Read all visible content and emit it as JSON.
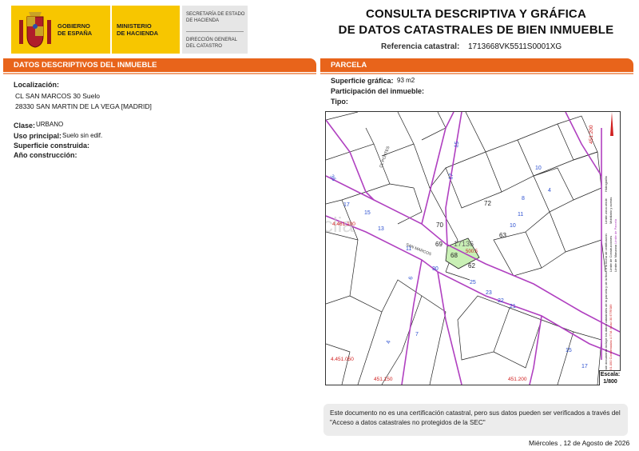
{
  "header": {
    "logo_line1": "GOBIERNO",
    "logo_line2": "DE ESPAÑA",
    "ministry_line1": "MINISTERIO",
    "ministry_line2": "DE HACIENDA",
    "secretaria_line1": "SECRETARÍA DE ESTADO",
    "secretaria_line2": "DE HACIENDA",
    "direccion_line1": "DIRECCIÓN GENERAL",
    "direccion_line2": "DEL CATASTRO",
    "title_line1": "CONSULTA DESCRIPTIVA Y GRÁFICA",
    "title_line2": "DE DATOS CATASTRALES DE BIEN INMUEBLE",
    "ref_label": "Referencia catastral:",
    "ref_value": "1713668VK5511S0001XG"
  },
  "left": {
    "section_title": "DATOS DESCRIPTIVOS DEL INMUEBLE",
    "localizacion_label": "Localización:",
    "address_line1": "CL SAN MARCOS 30 Suelo",
    "address_line2": "28330 SAN MARTIN DE LA VEGA [MADRID]",
    "clase_label": "Clase:",
    "clase_value": "URBANO",
    "uso_label": "Uso principal:",
    "uso_value": "Suelo sin edif.",
    "superficie_label": "Superficie construida:",
    "anio_label": "Año construcción:"
  },
  "right": {
    "section_title": "PARCELA",
    "sup_grafica_label": "Superficie gráfica:",
    "sup_grafica_value": "93 m2",
    "participacion_label": "Participación del inmueble:",
    "tipo_label": "Tipo:"
  },
  "map": {
    "parcel_color": "#c9f0b5",
    "boundary_color": "#b040c0",
    "street_color": "#2b4fd0",
    "coord_color": "#d02020",
    "watermark": "habitaclia",
    "street_sanmarcos": "SAN MARCOS",
    "street_ctpontes": "CL PONTES",
    "coord_left_top": "4.461.100",
    "coord_left_bottom": "4.451.050",
    "coord_bottom_mid": "451.150",
    "coord_bottom_right": "451.200",
    "coord_top_right": "451.200",
    "parcel_label": "68",
    "parcel_area": "500.5",
    "sheet_ref": "17136",
    "labels": {
      "n72": "72",
      "n70": "70",
      "n69": "69",
      "n63": "63",
      "n62": "62",
      "n36": "36",
      "n17": "17",
      "n13": "13",
      "n11": "11"
    },
    "side_text_1": "Este documento incluye los datos catastrales de la parcela y de la finca a la fecha de certificación",
    "side_text_2": "451.050 Coordenadas U.T.M. Huso 30 ETRS89",
    "legend_1": "Límite de Manzana",
    "legend_2": "Límite de Parcela",
    "legend_3": "Límite de Construcciones",
    "legend_4": "Mobiliario y aceras",
    "legend_5": "Límite zona verde",
    "legend_6": "Hidrografía",
    "scale_label": "Escala:",
    "scale_value": "1/800"
  },
  "footer": {
    "note": "Este documento no es una certificación catastral, pero sus datos pueden ser verificados a través del \"Acceso a datos catastrales no protegidos de la SEC\"",
    "date": "Miércoles , 12 de Agosto de 2026"
  }
}
